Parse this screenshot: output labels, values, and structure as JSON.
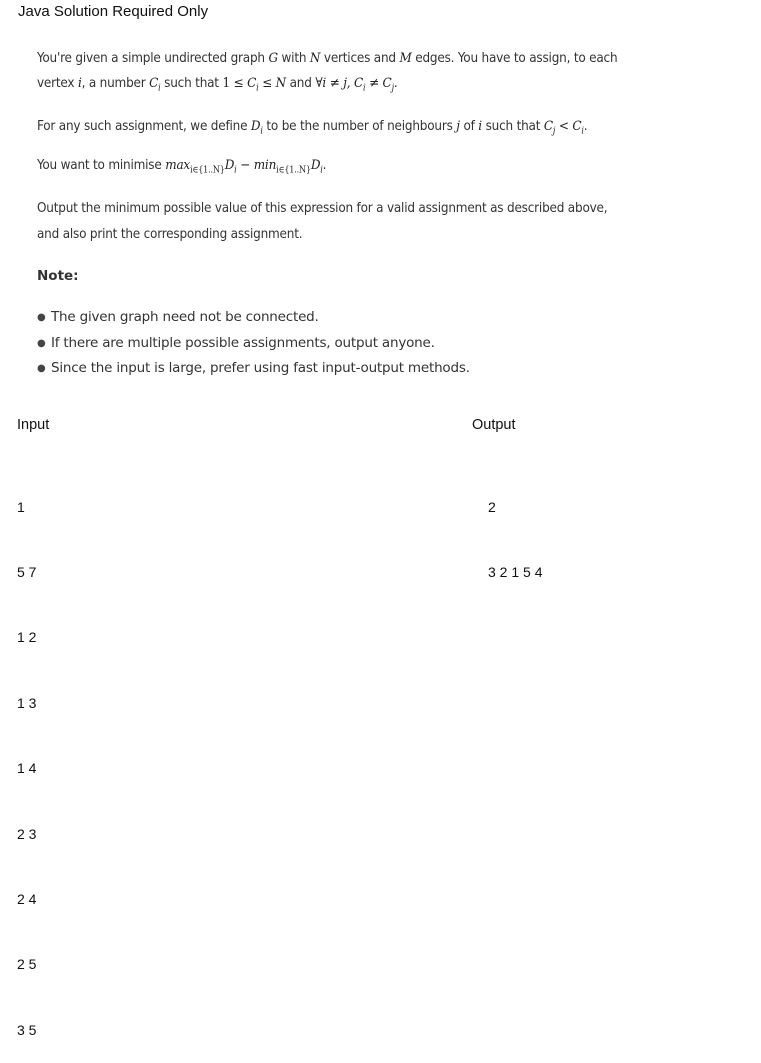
{
  "title": "Java Solution Required Only",
  "statement": {
    "p1_a": "You're given a simple undirected graph ",
    "p1_G": "G",
    "p1_b": " with ",
    "p1_N": "N",
    "p1_c": " vertices and ",
    "p1_M": "M",
    "p1_d": " edges. You have to assign, to each",
    "p2_a": "vertex ",
    "p2_i": "i",
    "p2_b": ", a number ",
    "p2_Ci": "C",
    "p2_sub_i": "i",
    "p2_c": " such that ",
    "p2_math": "1 ≤ ",
    "p2_math2": " ≤ ",
    "p2_N": "N",
    "p2_d": " and ",
    "p2_forall": "∀i ≠ j, C",
    "p2_ne": " ≠ C",
    "p2_sub_j": "j",
    "p2_end": ".",
    "p3_a": "For any such assignment, we define ",
    "p3_D": "D",
    "p3_b": " to be the number of neighbours ",
    "p3_j": "j",
    "p3_c": " of ",
    "p3_i": "i",
    "p3_d": " such that ",
    "p3_cmp": " < ",
    "p4_a": "You want to minimise ",
    "p4_max": "max",
    "p4_sub": "i∈{1..N}",
    "p4_minus": " − ",
    "p4_min": "min",
    "p5": "Output the minimum possible value of this expression for a valid assignment as described above,",
    "p6": "and also print the corresponding assignment."
  },
  "note": {
    "heading": "Note:",
    "items": [
      "The given graph need not be connected.",
      "If there are multiple possible assignments, output anyone.",
      "Since the input is large, prefer using fast input-output methods."
    ]
  },
  "example": {
    "input_label": "Input",
    "output_label": "Output",
    "input_lines": [
      "1",
      "5 7",
      "1 2",
      "1 3",
      "1 4",
      "2 3",
      "2 4",
      "2 5",
      "3 5"
    ],
    "output_lines": [
      "2",
      "3 2 1 5 4"
    ]
  }
}
